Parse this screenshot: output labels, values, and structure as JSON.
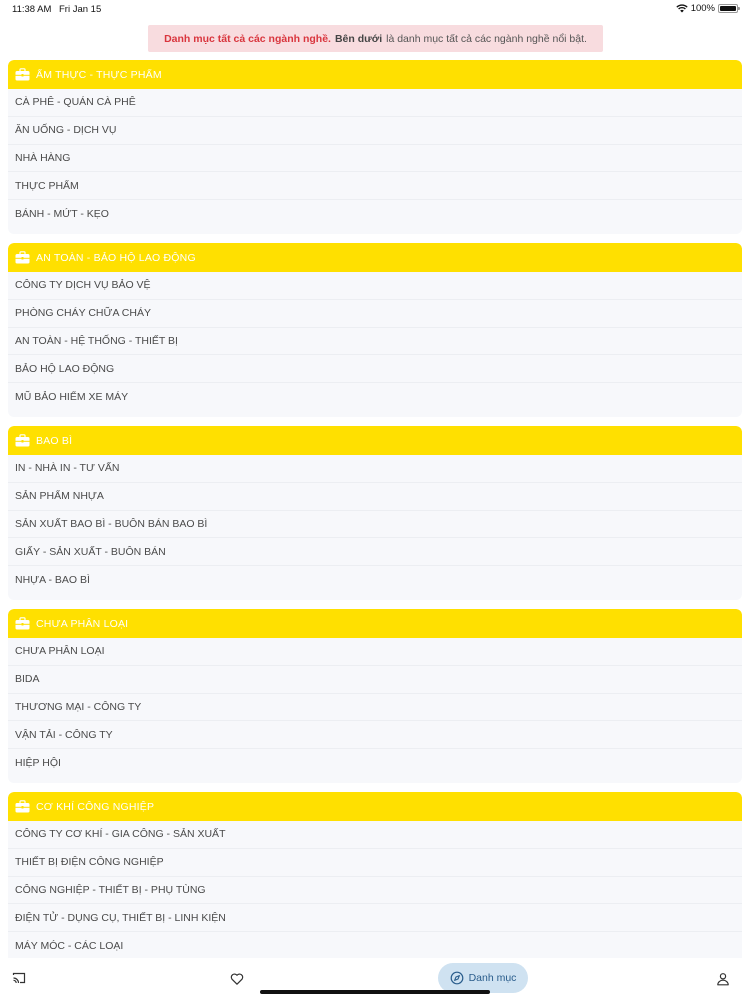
{
  "status_bar": {
    "time": "11:38 AM",
    "date": "Fri Jan 15",
    "battery": "100%"
  },
  "banner": {
    "title": "Danh mục tất cả các ngành nghề.",
    "emph": "Bên dưới",
    "text": "là danh mục tất cả các ngành nghề nổi bật."
  },
  "categories": [
    {
      "title": "ẨM THỰC - THỰC PHẨM",
      "items": [
        "CÀ PHÊ - QUÁN CÀ PHÊ",
        "ĂN UỐNG - DỊCH VỤ",
        "NHÀ HÀNG",
        "THỰC PHẨM",
        "BÁNH - MỨT - KẸO"
      ]
    },
    {
      "title": "AN TOÀN - BẢO HỘ LAO ĐỘNG",
      "items": [
        "CÔNG TY DỊCH VỤ BẢO VỆ",
        "PHÒNG CHÁY CHỮA CHÁY",
        "AN TOÀN - HỆ THỐNG - THIẾT BỊ",
        "BẢO HỘ LAO ĐỘNG",
        "MŨ BẢO HIỂM XE MÁY"
      ]
    },
    {
      "title": "BAO BÌ",
      "items": [
        "IN - NHÀ IN - TƯ VẤN",
        "SẢN PHẨM NHỰA",
        "SẢN XUẤT BAO BÌ - BUÔN BÁN BAO BÌ",
        "GIẤY - SẢN XUẤT - BUÔN BÁN",
        "NHỰA - BAO BÌ"
      ]
    },
    {
      "title": "CHƯA PHÂN LOẠI",
      "items": [
        "CHƯA PHÂN LOẠI",
        "BIDA",
        "THƯƠNG MẠI - CÔNG TY",
        "VẬN TẢI - CÔNG TY",
        "HIỆP HỘI"
      ]
    },
    {
      "title": "CƠ KHÍ CÔNG NGHIỆP",
      "items": [
        "CÔNG TY CƠ KHÍ - GIA CÔNG - SẢN XUẤT",
        "THIẾT BỊ ĐIỆN CÔNG NGHIỆP",
        "CÔNG NGHIỆP - THIẾT BỊ - PHỤ TÙNG",
        "ĐIỆN TỬ - DỤNG CỤ, THIẾT BỊ - LINH KIỆN",
        "MÁY MÓC - CÁC LOẠI"
      ]
    }
  ],
  "tab_bar": {
    "active_label": "Danh mục",
    "icons": [
      "cast-icon",
      "heart-icon",
      "compass-icon",
      "user-icon"
    ]
  },
  "colors": {
    "header": "#ffe000",
    "banner_bg": "#f8dcdf",
    "accent_red": "#d9363e",
    "active_tab_bg": "#cfe2f1"
  }
}
